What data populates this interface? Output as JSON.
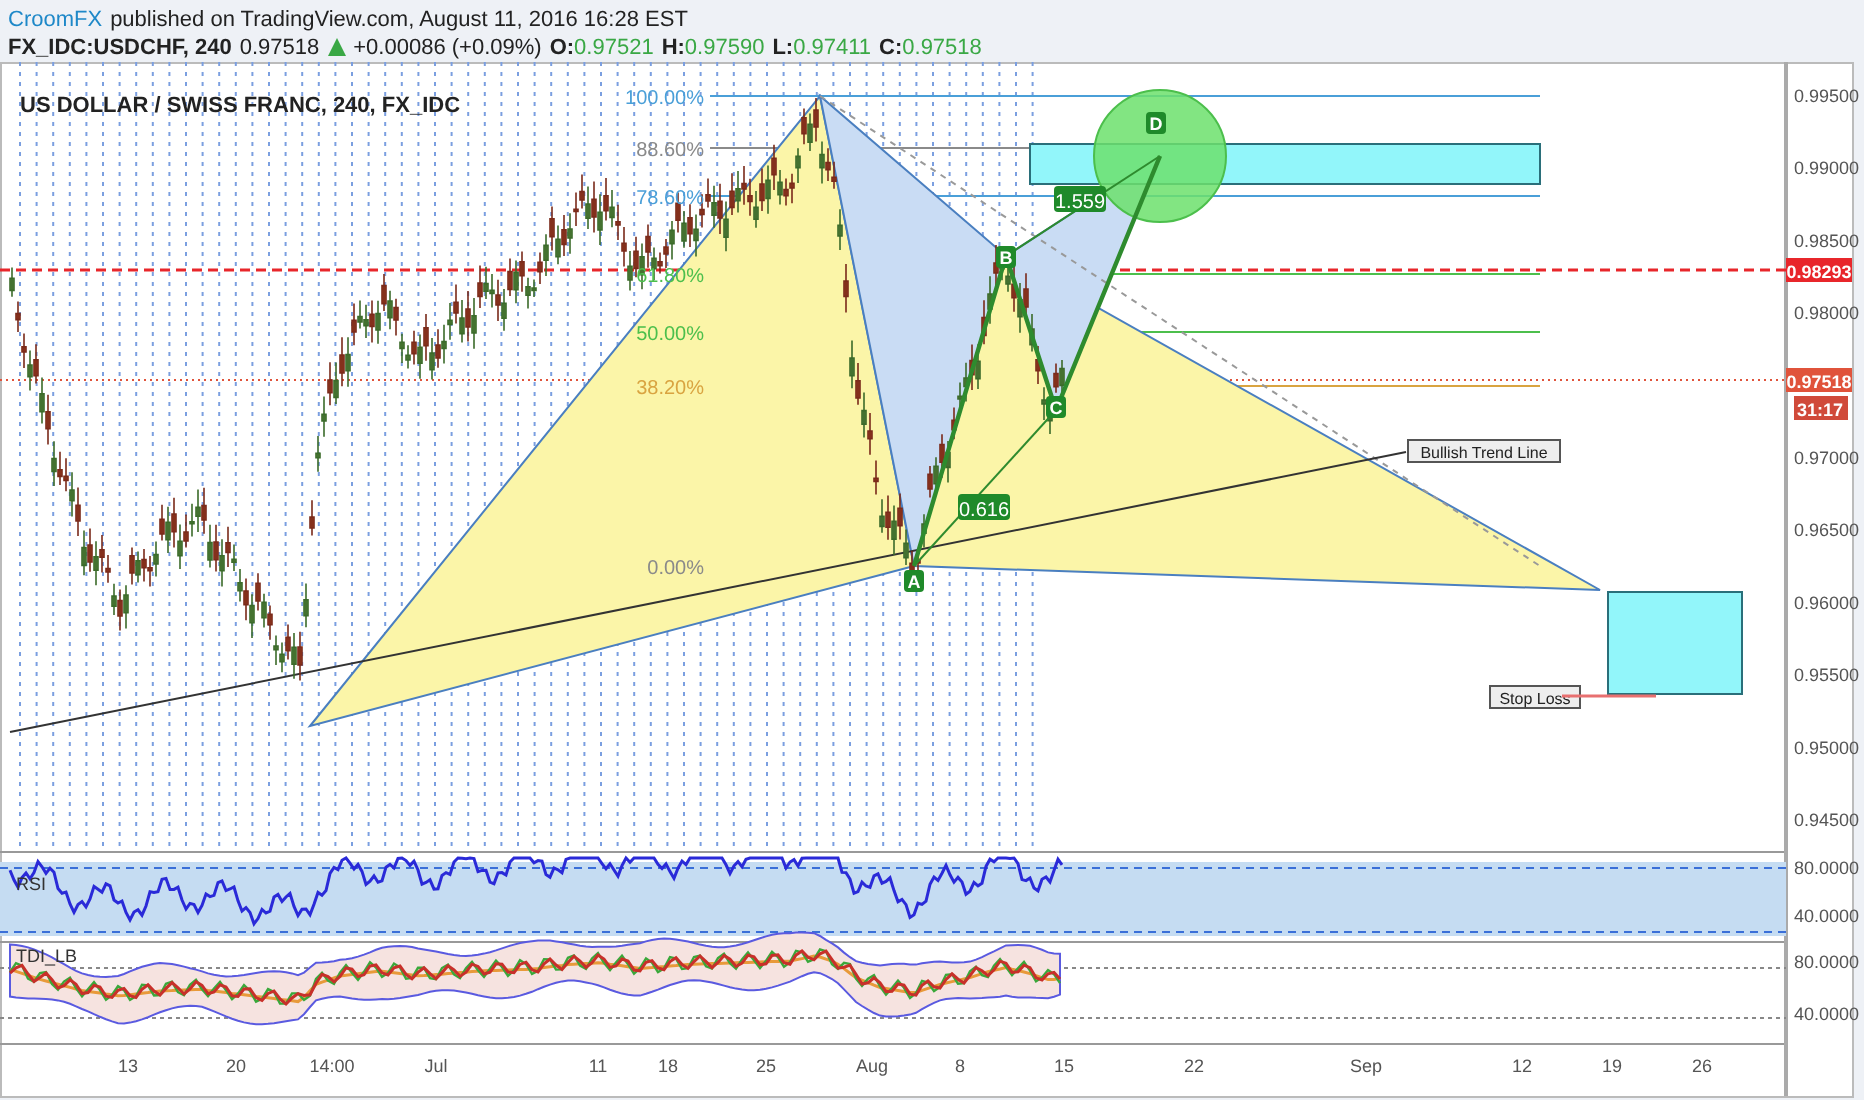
{
  "header": {
    "author": "CroomFX",
    "published": "published on TradingView.com, August 11, 2016 16:28 EST"
  },
  "quote": {
    "symbol": "FX_IDC:USDCHF, 240",
    "last": "0.97518",
    "rising": true,
    "change": "+0.00086 (+0.09%)",
    "ohlc": [
      {
        "label": "O:",
        "value": "0.97521"
      },
      {
        "label": "H:",
        "value": "0.97590"
      },
      {
        "label": "L:",
        "value": "0.97411"
      },
      {
        "label": "C:",
        "value": "0.97518"
      }
    ]
  },
  "chart": {
    "title": "US DOLLAR / SWISS FRANC, 240, FX_IDC",
    "price_axis": [
      "0.99500",
      "0.99000",
      "0.98500",
      "0.98000",
      "0.97000",
      "0.96500",
      "0.96000",
      "0.95500",
      "0.95000",
      "0.94500"
    ],
    "price_labels": [
      {
        "kind": "line",
        "text": "0.98293",
        "color": "#e8262b"
      },
      {
        "kind": "last",
        "text": "0.97518",
        "color": "#e0533b"
      },
      {
        "kind": "timer",
        "text": "31:17",
        "color": "#d04a3a"
      }
    ],
    "fib_levels": [
      {
        "label": "100.00%",
        "color": "#4a9fd8"
      },
      {
        "label": "88.60%",
        "color": "#8a8a8a"
      },
      {
        "label": "78.60%",
        "color": "#4a9fd8"
      },
      {
        "label": "61.80%",
        "color": "#4cbf4c"
      },
      {
        "label": "50.00%",
        "color": "#4cbf4c"
      },
      {
        "label": "38.20%",
        "color": "#d9a441"
      },
      {
        "label": "0.00%",
        "color": "#8a8a8a"
      }
    ],
    "pattern_points": [
      "A",
      "B",
      "C",
      "D"
    ],
    "ratios": [
      "0.616",
      "1.559"
    ],
    "notes": [
      "Bullish Trend Line",
      "Stop Loss"
    ],
    "rsi": {
      "label": "RSI",
      "ticks": [
        "80.0000",
        "40.0000"
      ]
    },
    "tdi": {
      "label": "TDI_LB",
      "ticks": [
        "80.0000",
        "40.0000"
      ]
    },
    "time_axis": [
      "13",
      "20",
      "14:00",
      "Jul",
      "11",
      "18",
      "25",
      "Aug",
      "8",
      "15",
      "22",
      "Sep",
      "12",
      "19",
      "26"
    ]
  }
}
